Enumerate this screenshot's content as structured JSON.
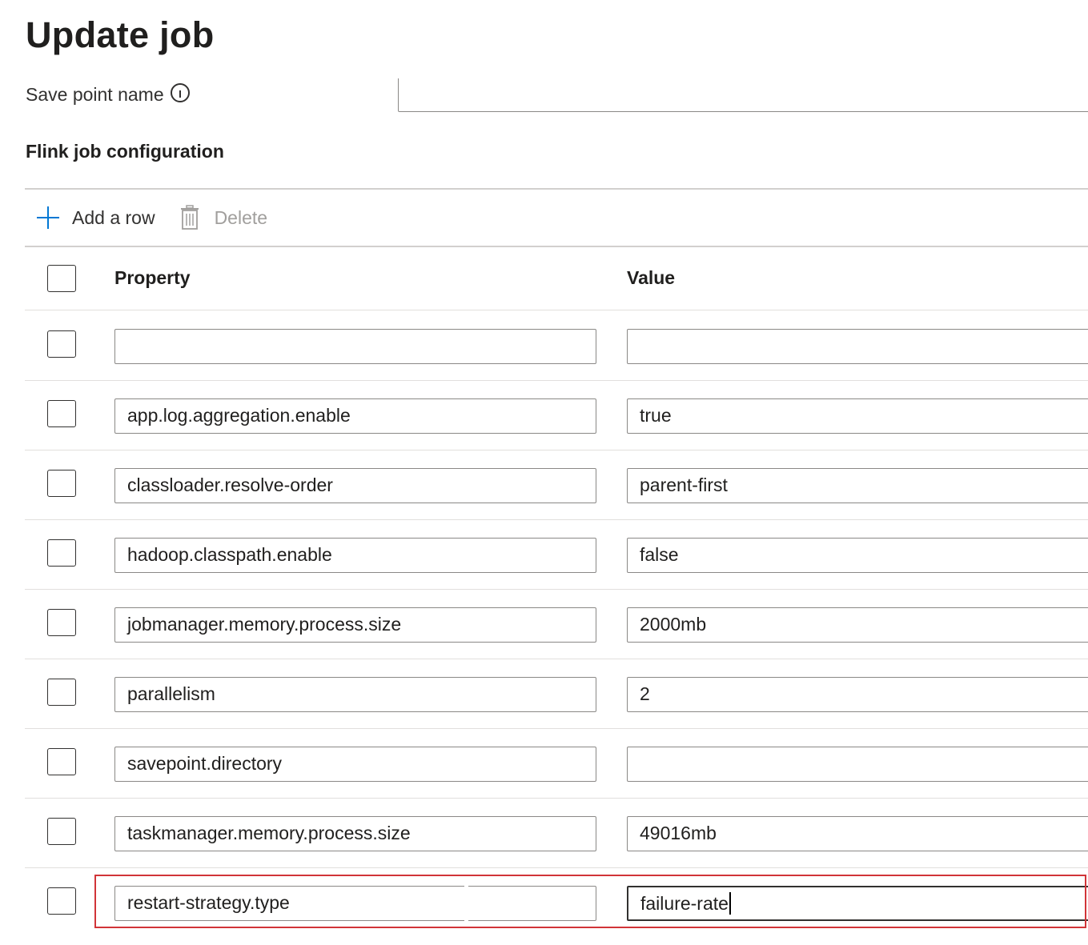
{
  "page": {
    "title": "Update job"
  },
  "savepoint": {
    "label": "Save point name",
    "value": ""
  },
  "section": {
    "heading": "Flink job configuration"
  },
  "toolbar": {
    "add_label": "Add a row",
    "delete_label": "Delete",
    "delete_enabled": false
  },
  "grid": {
    "columns": {
      "property": "Property",
      "value": "Value"
    },
    "rows": [
      {
        "property": "",
        "value": ""
      },
      {
        "property": "app.log.aggregation.enable",
        "value": "true"
      },
      {
        "property": "classloader.resolve-order",
        "value": "parent-first"
      },
      {
        "property": "hadoop.classpath.enable",
        "value": "false"
      },
      {
        "property": "jobmanager.memory.process.size",
        "value": "2000mb"
      },
      {
        "property": "parallelism",
        "value": "2"
      },
      {
        "property": "savepoint.directory",
        "value": ""
      },
      {
        "property": "taskmanager.memory.process.size",
        "value": "49016mb"
      },
      {
        "property": "restart-strategy.type",
        "value": "failure-rate",
        "focused": true,
        "highlighted": true
      }
    ]
  },
  "colors": {
    "accent": "#0078d4",
    "highlight": "#d13438",
    "border": "#8a8886",
    "divider": "#e1dfdd"
  }
}
